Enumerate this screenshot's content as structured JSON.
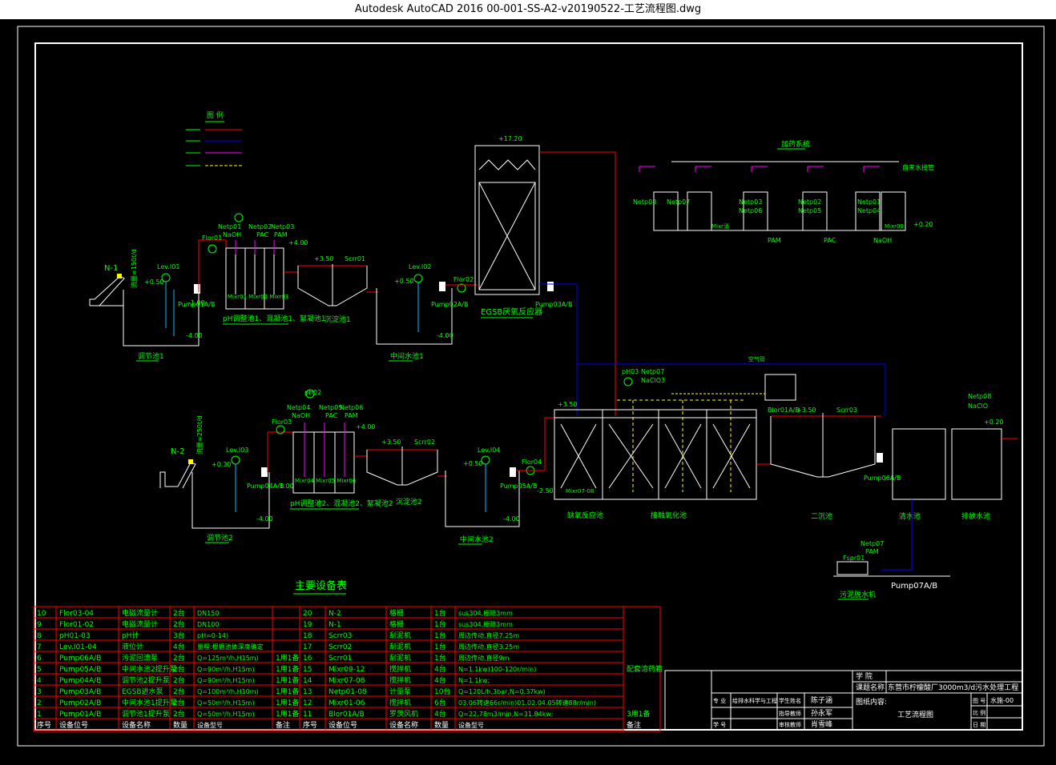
{
  "window": {
    "title": "Autodesk AutoCAD 2016     00-001-SS-A2-v20190522-工艺流程图.dwg"
  },
  "legend": {
    "title": "图 例"
  },
  "top_labels": {
    "n1": "N-1",
    "n1_rate": "流量=150t/d",
    "lev01": "Lev.I01",
    "flor01": "Flor01",
    "netp01": "Netp01",
    "naoh1": "NaOH",
    "netp02": "Netp02",
    "pac1": "PAC",
    "netp03": "Netp03",
    "pam1": "PAM",
    "h400a": "+4.00",
    "h350a": "+3.50",
    "scrr01": "Scrr01",
    "lev02": "Lev.I02",
    "flor02": "Flor02",
    "h050a": "+0.50",
    "h050b": "+0.50",
    "hm100a": "-1.00",
    "hm400a": "-4.00",
    "hm400b": "-4.00",
    "pump01": "Pump01A/B",
    "pump02": "Pump02A/B",
    "pump03": "Pump03A/B",
    "mixr": "Mixr01 Mixr02 Mixr03",
    "ph_tank1": "pH调整池1、混凝池1、絮凝池1",
    "tank_collect1": "调节池1",
    "tank_mid1": "中间水池1",
    "tank_sed1": "沉淀池1",
    "h1720": "+17.20",
    "egsb": "EGSB厌氧反应器"
  },
  "dosing": {
    "title": "加药系统",
    "water": "自来水接管",
    "netp08": "Netp08",
    "netp07": "Netp07",
    "netp03": "Netp03",
    "netp06": "Netp06",
    "netp02": "Netp02",
    "netp05": "Netp05",
    "netp01": "Netp01",
    "netp04": "Netp04",
    "h020": "+0.20",
    "t1": "Mixr消",
    "t2": "PAM",
    "t3": "PAC",
    "t4": "NaOH",
    "mixr09": "Mixr09"
  },
  "bottom_labels": {
    "n2": "N-2",
    "n2_rate": "流量=250t/d",
    "lev03": "Lev.I03",
    "flor03": "Flor03",
    "ph02": "pH02",
    "netp04": "Netp04",
    "naoh2": "NaOH",
    "netp05": "Netp05",
    "pac2": "PAC",
    "netp06": "Netp06",
    "pam2": "PAM",
    "h400b": "+4.00",
    "h350b": "+3.50",
    "scrr02": "Scrr02",
    "lev04": "Lev.I04",
    "flor04": "Flor04",
    "h030": "+0.30",
    "h050c": "+0.50",
    "hm100b": "-1.00",
    "hm400c": "-4.00",
    "hm400d": "-4.00",
    "pump04": "Pump04A/B",
    "pump05": "Pump05A/B",
    "mixr": "Mixr04 Mixr05 Mixr06",
    "ph_tank2": "pH调整池2、混凝池2、絮凝池2",
    "tank_collect2": "调节池2",
    "tank_sed2": "沉淀池2",
    "tank_mid2": "中间水池2",
    "ph03": "pH03",
    "netp07": "Netp07",
    "naclo": "NaClO3",
    "h350c": "+3.50",
    "hm250": "-2.50",
    "mixr0708": "Mixr07-08",
    "blor": "Blor01A/B",
    "h350d": "+3.50",
    "scrr03": "Scrr03",
    "netp08": "Netp08",
    "naclo2": "NaClO",
    "h020b": "+0.20",
    "pump06": "Pump06A/B",
    "anoxic": "缺氧反应池",
    "aerobic": "接触氧化池",
    "sec_sed": "二沉池",
    "buffer": "清水池",
    "out": "排放水池",
    "netp07b": "Netp07",
    "pam3": "PAM",
    "fspr": "Fspr01",
    "pump07": "Pump07A/B",
    "sludge": "污泥脱水机",
    "air": "空气管"
  },
  "table": {
    "title": "主要设备表",
    "rows": [
      [
        "10",
        "Flor03-04",
        "电磁流量计",
        "2台",
        "DN150",
        "",
        "20",
        "N-2",
        "格栅",
        "1台",
        "sus304,栅隙3mm",
        ""
      ],
      [
        "9",
        "Flor01-02",
        "电磁流量计",
        "2台",
        "DN100",
        "",
        "19",
        "N-1",
        "格栅",
        "1台",
        "sus304,栅隙3mm",
        ""
      ],
      [
        "8",
        "pH01-03",
        "pH计",
        "3台",
        "pH=0-14)",
        "",
        "18",
        "Scrr03",
        "刮泥机",
        "1台",
        "周边传动,直径7.25m",
        ""
      ],
      [
        "7",
        "Lev.I01-04",
        "液位计",
        "4台",
        "量程:根据池体深度确定",
        "",
        "17",
        "Scrr02",
        "刮泥机",
        "1台",
        "周边传动,直径3.25m",
        ""
      ],
      [
        "6",
        "Pump06A/B",
        "污泥回流泵",
        "2台",
        "Q=125m³/h,H15m)",
        "1用1备",
        "16",
        "Scrr01",
        "刮泥机",
        "1台",
        "周边传动,直径9m",
        ""
      ],
      [
        "5",
        "Pump05A/B",
        "中间水池2提升泵",
        "2台",
        "Q=90m³/h,H15m)",
        "1用1备",
        "15",
        "Mixr09-12",
        "搅拌机",
        "4台",
        "N=1.1kw)100-120r/min)",
        "配套溶药箱"
      ],
      [
        "4",
        "Pump04A/B",
        "调节池2提升泵",
        "2台",
        "Q=90m³/h,H15m)",
        "1用1备",
        "14",
        "Mixr07-08",
        "搅拌机",
        "4台",
        "N=1.1kw;",
        ""
      ],
      [
        "3",
        "Pump03A/B",
        "EGSB进水泵",
        "2台",
        "Q=100m³/h,H10m)",
        "1用1备",
        "13",
        "Netp01-08",
        "计量泵",
        "10台",
        "Q=120L/h,3bar,N=0.37kw)",
        ""
      ],
      [
        "2",
        "Pump02A/B",
        "中间水池1提升泵",
        "2台",
        "Q=50m³/h,H15m)",
        "1用1备",
        "12",
        "Mixr01-06",
        "搅拌机",
        "6台",
        "03.06转速66r/min)01.02.04.05转速88r/min)",
        ""
      ],
      [
        "1",
        "Pump01A/B",
        "调节池1提升泵",
        "2台",
        "Q=50m³/h,H15m)",
        "1用1备",
        "11",
        "Blor01A/B",
        "罗茨风机",
        "4台",
        "Q=22.78m3/min,N=31.84kw;",
        "3用1备"
      ]
    ],
    "header": [
      "序号",
      "设备位号",
      "设备名称",
      "数量",
      "设备型号",
      "备注",
      "序号",
      "设备位号",
      "设备名称",
      "数量",
      "设备型号",
      "备注"
    ]
  },
  "titleblock": {
    "school": "学 院",
    "project_label": "课题名称",
    "project": "东营市柠檬酸厂3000m3/d污水处理工程",
    "drawing_label": "图纸内容:",
    "drawing": "工艺流程图",
    "major_label": "专 业",
    "major": "给排水科学与工程",
    "student_label": "学生姓名",
    "student": "陈子涵",
    "teacher_label": "指导教师",
    "teacher": "孙永军",
    "reviewer_label": "审核教师",
    "reviewer": "肖雪峰",
    "id_label": "学 号",
    "sheet_label": "图 号",
    "sheet": "水施-00",
    "scale_label": "比 例",
    "date_label": "日 期"
  },
  "colors": {
    "bg": "#000000",
    "green": "#00ff00",
    "white": "#ffffff",
    "red": "#ff0000",
    "blue": "#0000ff",
    "magenta": "#ff00ff",
    "cyan": "#00c0ff",
    "yellow": "#ffff00"
  }
}
